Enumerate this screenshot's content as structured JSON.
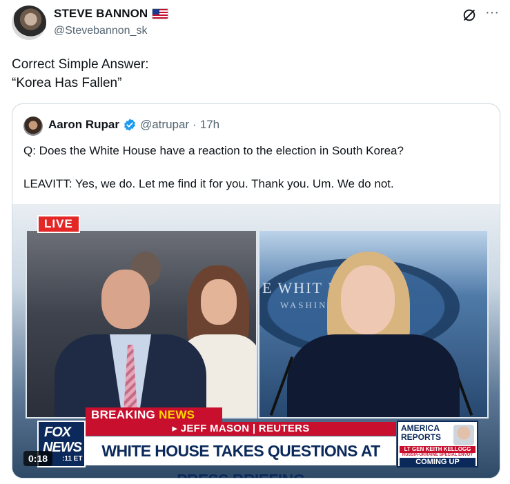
{
  "post": {
    "author": {
      "display_name": "STEVE BANNON",
      "handle": "@Stevebannon_sk",
      "flag_icon": "us-flag-icon"
    },
    "text_lines": [
      "Correct Simple Answer:",
      "“Korea Has Fallen”"
    ],
    "actions": {
      "grok_icon": "grok-icon",
      "more_label": "···"
    }
  },
  "quote": {
    "author": {
      "display_name": "Aaron Rupar",
      "handle": "@atrupar",
      "separator": "·",
      "time": "17h",
      "verified_icon": "verified-badge-icon"
    },
    "paragraphs": [
      "Q: Does the White House have a reaction to the election in South Korea?",
      "LEAVITT: Yes, we do. Let me find it for you. Thank you. Um. We do not."
    ],
    "video": {
      "live_label": "LIVE",
      "breaking_label_1": "BREAKING",
      "breaking_label_2": "NEWS",
      "reporter_line": "▸ JEFF MASON | REUTERS",
      "headline": "WHITE HOUSE TAKES QUESTIONS AT PRESS BRIEFING",
      "fox_line1": "FOX",
      "fox_line2": "NEWS",
      "fox_time": ":11 ET",
      "seal_text": "E WHIT      E",
      "seal_sub": "WASHIN",
      "promo": {
        "title": "AMERICA REPORTS",
        "guest": "LT GEN KEITH KELLOGG",
        "role": "RUSSIA-UKRAINE SPECIAL ENVOY",
        "coming": "COMING UP"
      },
      "duration": "0:18"
    }
  },
  "colors": {
    "text": "#0f1419",
    "muted": "#536471",
    "verified": "#1d9bf0",
    "fox_red": "#c8102e",
    "fox_navy": "#0b2a5b"
  }
}
